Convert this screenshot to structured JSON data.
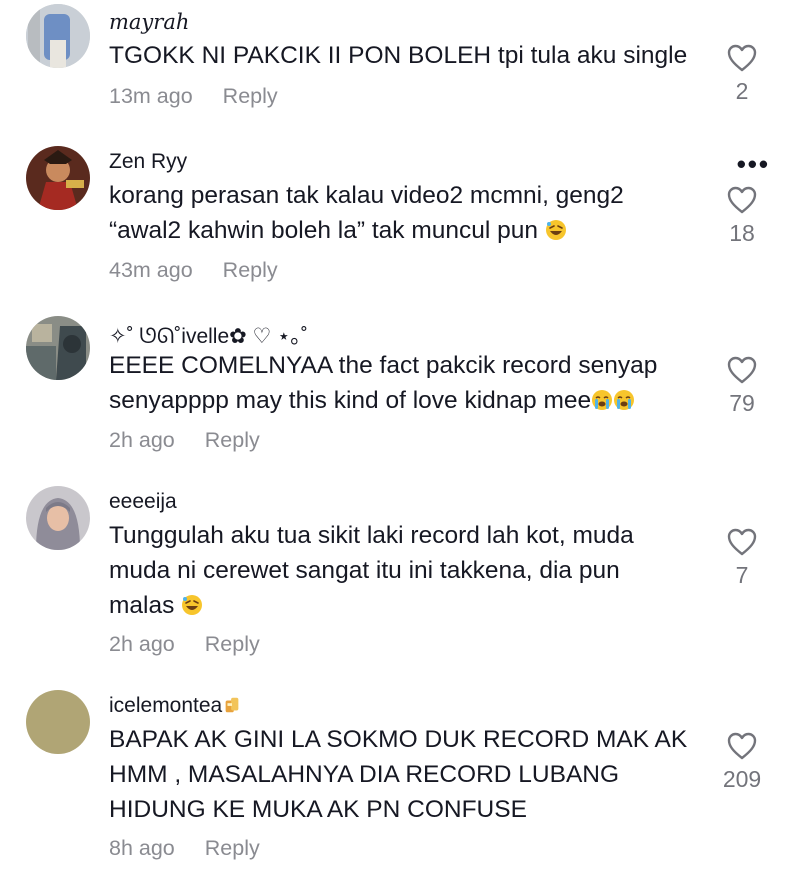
{
  "comments": [
    {
      "username": "mayrah",
      "text": "TGOKK NI PAKCIK II PON BOLEH tpi tula aku single",
      "time": "13m ago",
      "reply": "Reply",
      "likes": "2"
    },
    {
      "username": "Zen Ryy",
      "line1": "korang perasan tak kalau video2 mcmni, geng2",
      "line2": "“awal2 kahwin boleh la” tak muncul pun",
      "time": "43m ago",
      "reply": "Reply",
      "likes": "18",
      "more_icon": "more-options-icon",
      "emoji": "rofl-emoji"
    },
    {
      "username": "✧˚ ᘎᘏ˚ivelle✿ ♡ ⋆｡˚",
      "line1": "EEEE COMELNYAA the fact pakcik record senyap",
      "line2": "senyapppp may this kind of love kidnap mee",
      "time": "2h ago",
      "reply": "Reply",
      "likes": "79",
      "emoji": "crying-emoji"
    },
    {
      "username": "eeeeija",
      "line1": "Tunggulah aku tua sikit laki record lah kot, muda",
      "line2": "muda ni cerewet sangat itu ini takkena, dia pun",
      "line3": "malas",
      "time": "2h ago",
      "reply": "Reply",
      "likes": "7",
      "emoji": "rofl-emoji"
    },
    {
      "username": "icelemontea",
      "line1": "BAPAK AK GINI LA SOKMO DUK RECORD MAK AK",
      "line2": "HMM , MASALAHNYA DIA RECORD LUBANG",
      "line3": "HIDUNG KE MUKA AK PN CONFUSE",
      "time": "8h ago",
      "reply": "Reply",
      "likes": "209",
      "emoji": "drink-emoji"
    }
  ],
  "icons": {
    "like": "heart-outline-icon"
  },
  "colors": {
    "text": "#161823",
    "meta": "#8a8b91",
    "like_count": "#73747b",
    "emoji_yellow": "#f7c52c"
  }
}
